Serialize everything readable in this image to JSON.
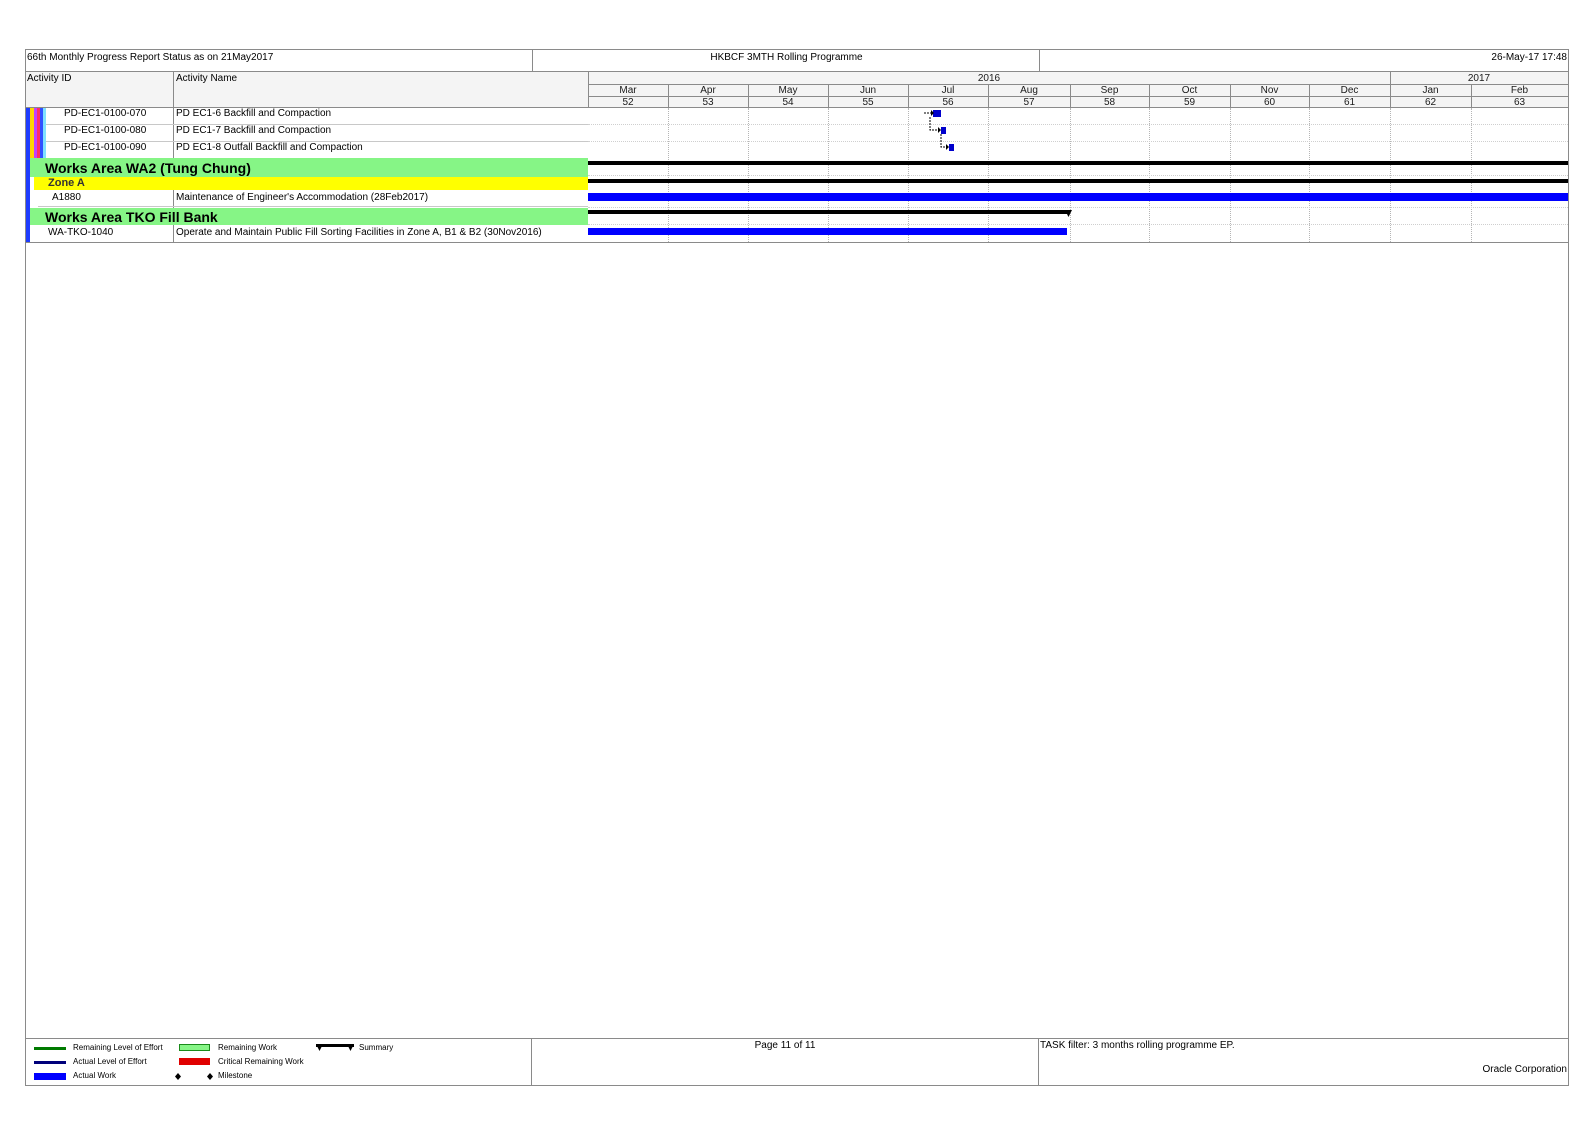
{
  "header": {
    "left_title": "66th Monthly Progress Report Status as on 21May2017",
    "center_title": "HKBCF 3MTH Rolling Programme",
    "right_date": "26-May-17 17:48"
  },
  "columns": {
    "activity_id": "Activity ID",
    "activity_name": "Activity Name"
  },
  "timeline": {
    "years": [
      {
        "label": "2016"
      },
      {
        "label": "2017"
      }
    ],
    "months": [
      "Mar",
      "Apr",
      "May",
      "Jun",
      "Jul",
      "Aug",
      "Sep",
      "Oct",
      "Nov",
      "Dec",
      "Jan",
      "Feb"
    ],
    "periods": [
      "52",
      "53",
      "54",
      "55",
      "56",
      "57",
      "58",
      "59",
      "60",
      "61",
      "62",
      "63"
    ]
  },
  "rows": [
    {
      "type": "activity",
      "id": "PD-EC1-0100-070",
      "name": "PD EC1-6 Backfill and Compaction"
    },
    {
      "type": "activity",
      "id": "PD-EC1-0100-080",
      "name": "PD EC1-7 Backfill and Compaction"
    },
    {
      "type": "activity",
      "id": "PD-EC1-0100-090",
      "name": "PD EC1-8 Outfall Backfill and Compaction"
    },
    {
      "type": "wbs",
      "label": "Works Area WA2 (Tung Chung)"
    },
    {
      "type": "wbs2",
      "label": "Zone A"
    },
    {
      "type": "activity",
      "id": "A1880",
      "name": "Maintenance of Engineer's Accommodation (28Feb2017)"
    },
    {
      "type": "wbs",
      "label": "Works Area TKO Fill Bank"
    },
    {
      "type": "activity",
      "id": "WA-TKO-1040",
      "name": "Operate and Maintain Public Fill Sorting Facilities in Zone A, B1 & B2 (30Nov2016)"
    }
  ],
  "colors": {
    "wbs_green": "#86f586",
    "wbs_yellow": "#ffff00",
    "actual_work": "#0000ff",
    "summary": "#000000",
    "critical": "#e00000",
    "level_effort_remaining": "#007a00",
    "level_effort_actual": "#00007a"
  },
  "footer": {
    "page": "Page 11 of 11",
    "filter": "TASK filter: 3 months rolling programme EP.",
    "company": "Oracle Corporation",
    "legend": [
      {
        "label": "Remaining Level of Effort",
        "icon": "remaining-level-of-effort-swatch"
      },
      {
        "label": "Actual Level of Effort",
        "icon": "actual-level-of-effort-swatch"
      },
      {
        "label": "Actual Work",
        "icon": "actual-work-swatch"
      },
      {
        "label": "Remaining Work",
        "icon": "remaining-work-swatch"
      },
      {
        "label": "Critical Remaining Work",
        "icon": "critical-remaining-work-swatch"
      },
      {
        "label": "Milestone",
        "icon": "milestone-icon"
      },
      {
        "label": "Summary",
        "icon": "summary-bar-icon"
      }
    ]
  }
}
